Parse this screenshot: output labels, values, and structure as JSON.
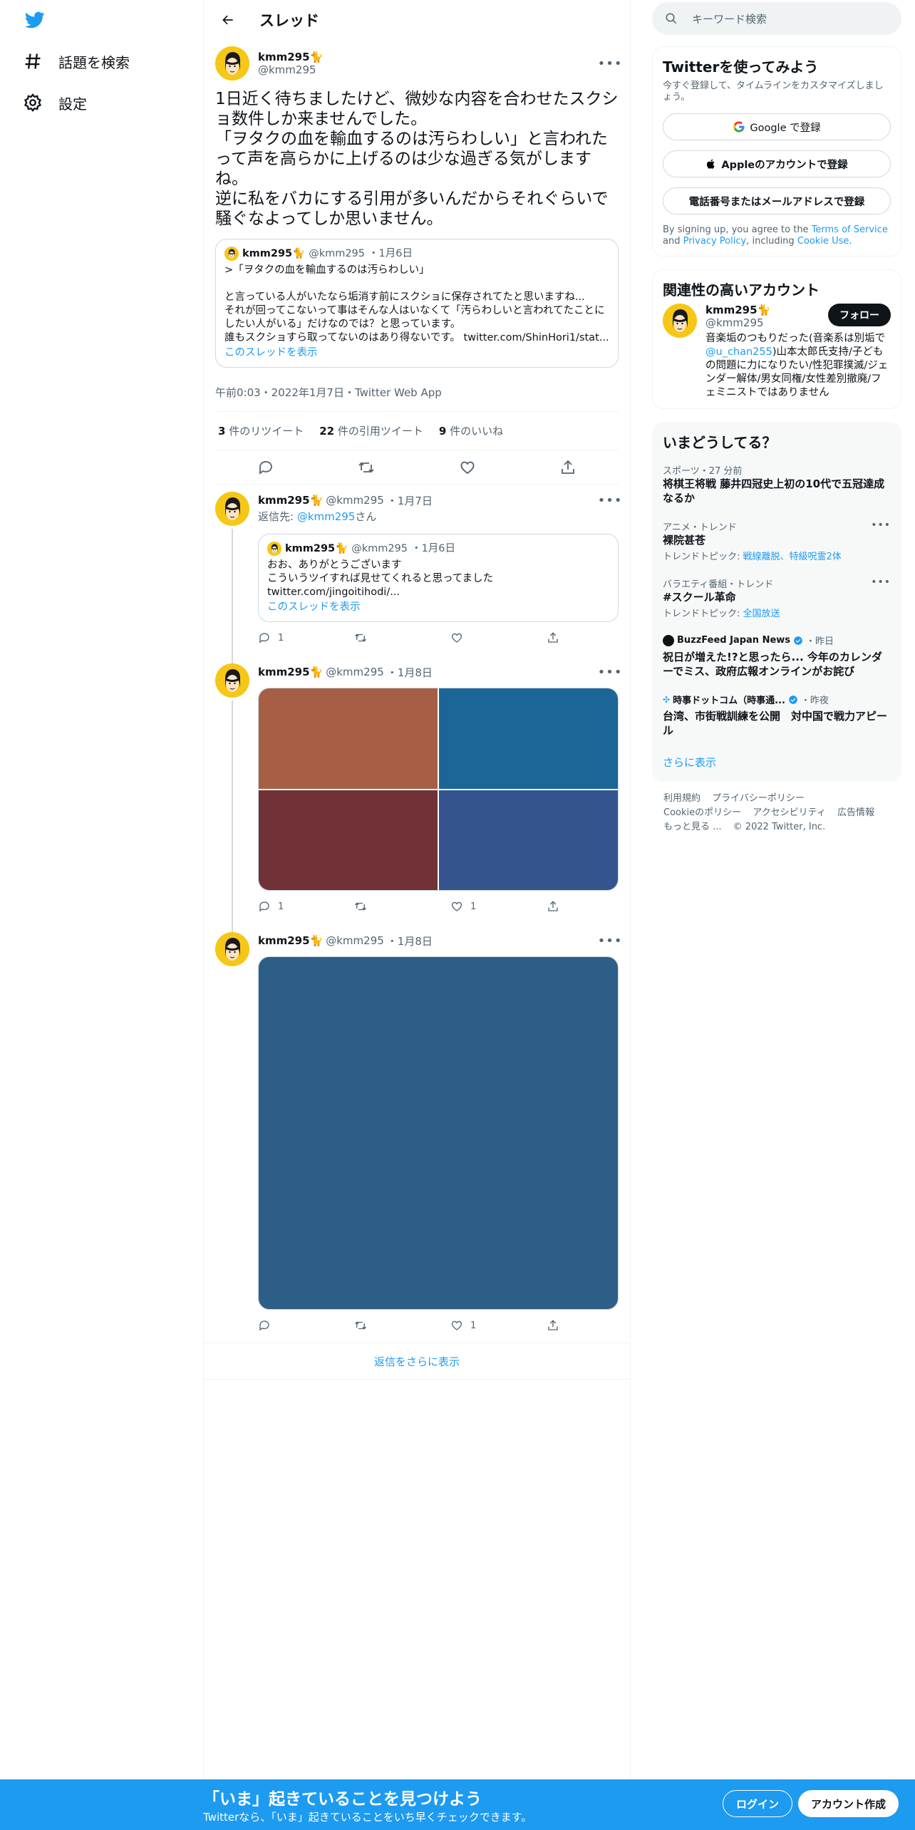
{
  "nav": {
    "logo": "twitter-bird-icon",
    "items": [
      {
        "icon": "hashtag-icon",
        "label": "話題を検索"
      },
      {
        "icon": "gear-icon",
        "label": "設定"
      }
    ]
  },
  "header": {
    "title": "スレッド"
  },
  "main_tweet": {
    "name": "kmm295🐈",
    "handle": "@kmm295",
    "text": "1日近く待ちましたけど、微妙な内容を合わせたスクショ数件しか来ませんでした。\n「ヲタクの血を輸血するのは汚らわしい」と言われたって声を高らかに上げるのは少な過ぎる気がしますね。\n逆に私をバカにする引用が多いんだからそれぐらいで騒ぐなよってしか思いません。",
    "quote": {
      "name": "kmm295🐈",
      "handle": "@kmm295",
      "date": "・1月6日",
      "text": ">「ヲタクの血を輸血するのは汚らわしい」\n\nと言っている人がいたなら垢消す前にスクショに保存されてたと思いますね...\nそれが回ってこないって事はそんな人はいなくて「汚らわしいと言われてたことにしたい人がいる」だけなのでは？と思っています。\n誰もスクショすら取ってないのはあり得ないです。 twitter.com/ShinHori1/stat...",
      "link": "このスレッドを表示"
    },
    "meta": "午前0:03・2022年1月7日・Twitter Web App",
    "stats": {
      "retweets": "3",
      "retweets_label": " 件のリツイート",
      "quotes": "22",
      "quotes_label": " 件の引用ツイート",
      "likes": "9",
      "likes_label": " 件のいいね"
    }
  },
  "replies": [
    {
      "name": "kmm295🐈",
      "handle": "@kmm295",
      "date": "・1月7日",
      "reply_to_label": "返信先: ",
      "reply_to": "@kmm295",
      "reply_to_suffix": "さん",
      "quote": {
        "name": "kmm295🐈",
        "handle": "@kmm295",
        "date": "・1月6日",
        "text": "おお、ありがとうございます\nこういうツイすれば見せてくれると思ってました\ntwitter.com/jingoitihodi/...",
        "link": "このスレッドを表示"
      },
      "counts": {
        "reply": "1",
        "retweet": "",
        "like": ""
      }
    },
    {
      "name": "kmm295🐈",
      "handle": "@kmm295",
      "date": "・1月8日",
      "images": [
        "#a65f44",
        "#1b6697",
        "#703237",
        "#33548f"
      ],
      "counts": {
        "reply": "1",
        "retweet": "",
        "like": "1"
      }
    },
    {
      "name": "kmm295🐈",
      "handle": "@kmm295",
      "date": "・1月8日",
      "image_color": "#2c5e87",
      "counts": {
        "reply": "",
        "retweet": "",
        "like": "1"
      }
    }
  ],
  "show_more_replies": "返信をさらに表示",
  "search": {
    "placeholder": "キーワード検索"
  },
  "signup_panel": {
    "title": "Twitterを使ってみよう",
    "desc": "今すぐ登録して、タイムラインをカスタマイズしましょう。",
    "google": "Google で登録",
    "apple": "Appleのアカウントで登録",
    "phone": "電話番号またはメールアドレスで登録",
    "terms_pre": "By signing up, you agree to the ",
    "terms_tos": "Terms of Service",
    "terms_and": " and ",
    "terms_privacy": "Privacy Policy",
    "terms_incl": ", including ",
    "terms_cookie": "Cookie Use",
    "terms_end": "."
  },
  "related": {
    "title": "関連性の高いアカウント",
    "name": "kmm295🐈",
    "handle": "@kmm295",
    "follow": "フォロー",
    "bio_pre": "音楽垢のつもりだった(音楽系は別垢で",
    "bio_mention": "@u_chan255",
    "bio_post": ")山本太郎氏支持/子どもの問題に力になりたい/性犯罪撲滅/ジェンダー解体/男女同権/女性差別撤廃/フェミニストではありません"
  },
  "trends": {
    "title": "いまどうしてる？",
    "items": [
      {
        "cat": "スポーツ・27 分前",
        "title": "将棋王将戦 藤井四冠史上初の10代で五冠達成なるか",
        "sub_pre": "",
        "sub_links": ""
      },
      {
        "cat": "アニメ・トレンド",
        "title": "裸院甚苍",
        "sub_pre": "トレンドトピック: ",
        "sub_links": "戦線離脱、特級呪霊2体"
      },
      {
        "cat": "バラエティ番組・トレンド",
        "title": "#スクール革命",
        "sub_pre": "トレンドトピック: ",
        "sub_links": "全国放送"
      }
    ],
    "news": [
      {
        "source": "BuzzFeed Japan News",
        "time": "・昨日",
        "title": "祝日が増えた!?と思ったら... 今年のカレンダーでミス、政府広報オンラインがお詫び"
      },
      {
        "source": "時事ドットコム（時事通...",
        "time": "・昨夜",
        "title": "台湾、市街戦訓練を公開　対中国で戦力アピール"
      }
    ],
    "show_more": "さらに表示"
  },
  "footer": {
    "links": [
      "利用規約",
      "プライバシーポリシー",
      "Cookieのポリシー",
      "アクセシビリティ",
      "広告情報",
      "もっと見る ...",
      "© 2022 Twitter, Inc."
    ]
  },
  "bottom_bar": {
    "title": "「いま」起きていることを見つけよう",
    "sub": "Twitterなら、「いま」起きていることをいち早くチェックできます。",
    "login": "ログイン",
    "signup": "アカウント作成"
  },
  "colors": {
    "accent": "#1d9bf0",
    "bottom_bar": "#1d9bf0",
    "avatar_bg": "#f6c717"
  }
}
